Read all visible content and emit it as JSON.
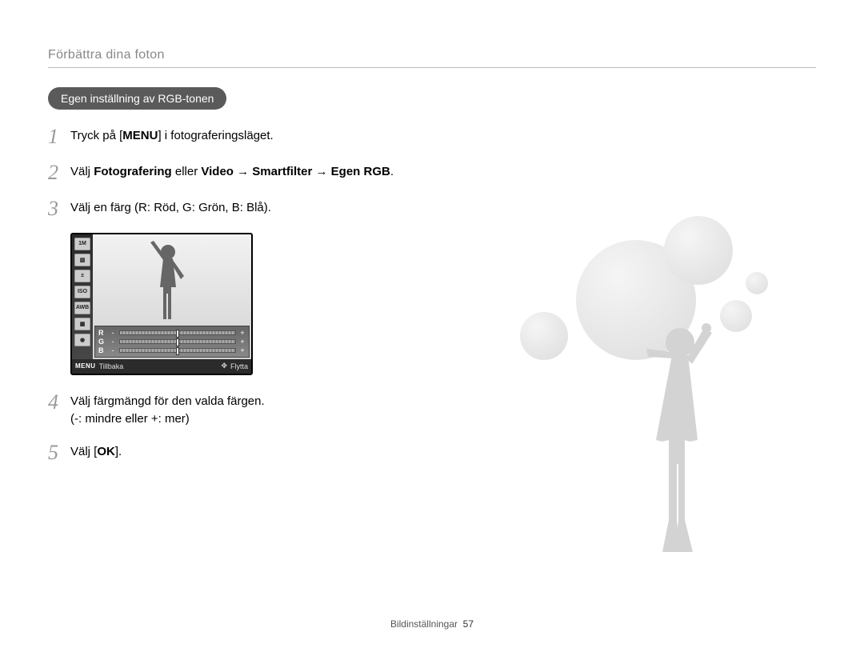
{
  "header": {
    "title": "Förbättra dina foton"
  },
  "pill": {
    "label": "Egen inställning av RGB-tonen"
  },
  "steps": {
    "s1": {
      "num": "1",
      "pre": "Tryck på [",
      "menu": "MENU",
      "post": "] i fotograferingsläget."
    },
    "s2": {
      "num": "2",
      "pre": "Välj ",
      "b1": "Fotografering",
      "mid1": " eller ",
      "b2": "Video",
      "mid2": " → ",
      "b3": "Smartfilter",
      "mid3": " → ",
      "b4": "Egen RGB",
      "post": "."
    },
    "s3": {
      "num": "3",
      "text": "Välj en färg (R: Röd, G: Grön, B: Blå)."
    },
    "s4": {
      "num": "4",
      "line1": "Välj färgmängd för den valda färgen.",
      "line2": "(-: mindre eller +: mer)"
    },
    "s5": {
      "num": "5",
      "pre": "Välj [",
      "ok": "OK",
      "post": "]."
    }
  },
  "lcd": {
    "icons": [
      "1M",
      "▧",
      "±",
      "ISO",
      "AWB",
      "▦",
      "◉"
    ],
    "sliders": [
      {
        "label": "R"
      },
      {
        "label": "G"
      },
      {
        "label": "B"
      }
    ],
    "bottom": {
      "menu": "MENU",
      "back": "Tillbaka",
      "nav": "✥",
      "move": "Flytta"
    }
  },
  "footer": {
    "section": "Bildinställningar",
    "page": "57"
  }
}
